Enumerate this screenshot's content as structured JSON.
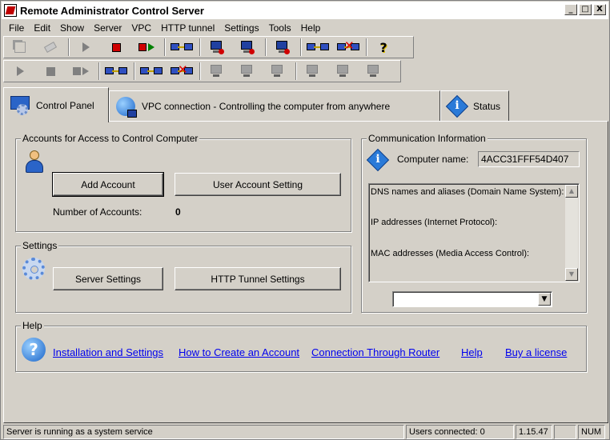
{
  "window": {
    "title": "Remote Administrator Control Server",
    "controls": {
      "minimize": "_",
      "maximize": "□",
      "close": "X"
    }
  },
  "menu": [
    "File",
    "Edit",
    "Show",
    "Server",
    "VPC",
    "HTTP tunnel",
    "Settings",
    "Tools",
    "Help"
  ],
  "toolbar1_icons": [
    "copy-icon",
    "eraser-icon",
    "play-icon",
    "stop-icon",
    "stop-play-icon",
    "connect-icon",
    "pc-icon",
    "pc-icon",
    "pc-icon",
    "connect-icon",
    "disconnect-icon",
    "help-question-icon"
  ],
  "toolbar1_help": "?",
  "toolbar2_icons": [
    "play-icon",
    "stop-icon",
    "stop-play-icon",
    "connect-icon",
    "connect-icon",
    "disconnect-icon",
    "pc-icon",
    "pc-icon",
    "pc-icon",
    "pc-icon",
    "pc-icon",
    "pc-icon"
  ],
  "tabs": [
    {
      "label": "Control Panel",
      "icon": "control-panel-icon"
    },
    {
      "label": "VPC connection - Controlling the computer from anywhere",
      "icon": "globe-icon"
    },
    {
      "label": "Status",
      "icon": "info-icon"
    }
  ],
  "accounts": {
    "title": "Accounts for Access to Control Computer",
    "add_account": "Add Account",
    "user_account_setting": "User Account Setting",
    "count_label": "Number of Accounts:",
    "count_value": "0"
  },
  "settings": {
    "title": "Settings",
    "server_settings": "Server Settings",
    "http_tunnel_settings": "HTTP Tunnel Settings"
  },
  "comm": {
    "title": "Communication Information",
    "computer_name_label": "Computer name:",
    "computer_name_value": "4ACC31FFF54D407",
    "info_glyph": "i",
    "lines": [
      "DNS names and aliases (Domain Name System):",
      "IP addresses (Internet Protocol):",
      "MAC addresses (Media Access Control):"
    ],
    "scroll_up": "▲",
    "scroll_down": "▼",
    "combo_arrow": "▼",
    "combo_value": ""
  },
  "help": {
    "title": "Help",
    "glyph": "?",
    "links": [
      "Installation and Settings",
      "How to Create an Account",
      "Connection Through Router",
      "Help",
      "Buy a license"
    ]
  },
  "status": {
    "message": "Server is running as a system service",
    "users": "Users connected: 0",
    "version": "1.15.47",
    "num": "NUM"
  }
}
